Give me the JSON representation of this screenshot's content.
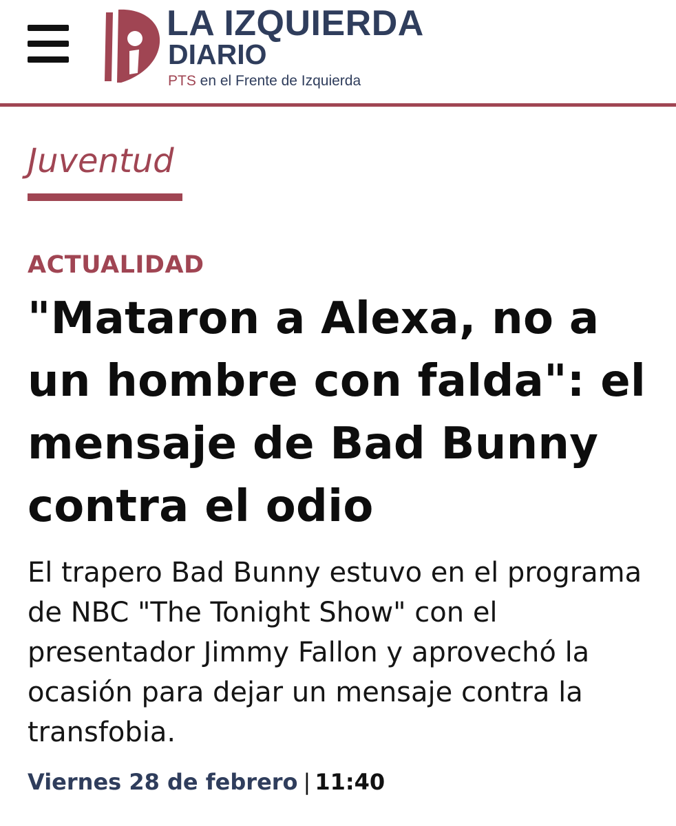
{
  "header": {
    "brand_line1": "LA IZQUIERDA",
    "brand_line2": "DIARIO",
    "tagline_highlight": "PTS",
    "tagline_rest": " en el Frente de Izquierda"
  },
  "section": {
    "label": "Juventud"
  },
  "article": {
    "kicker": "ACTUALIDAD",
    "headline": "\"Mataron a Alexa, no a un hombre con falda\": el mensaje de Bad Bunny contra el odio",
    "deck": "El trapero Bad Bunny estuvo en el programa de NBC \"The Tonight Show\" con el presentador Jimmy Fallon y aprovechó la ocasión para dejar un mensaje contra la transfobia.",
    "date": "Viernes 28 de febrero",
    "separator": "|",
    "time": "11:40"
  },
  "colors": {
    "accent": "#a04553",
    "navy": "#2f3d5c",
    "text": "#111111"
  },
  "icons": {
    "menu": "hamburger-menu-icon",
    "logo": "la-izquierda-diario-logo"
  }
}
